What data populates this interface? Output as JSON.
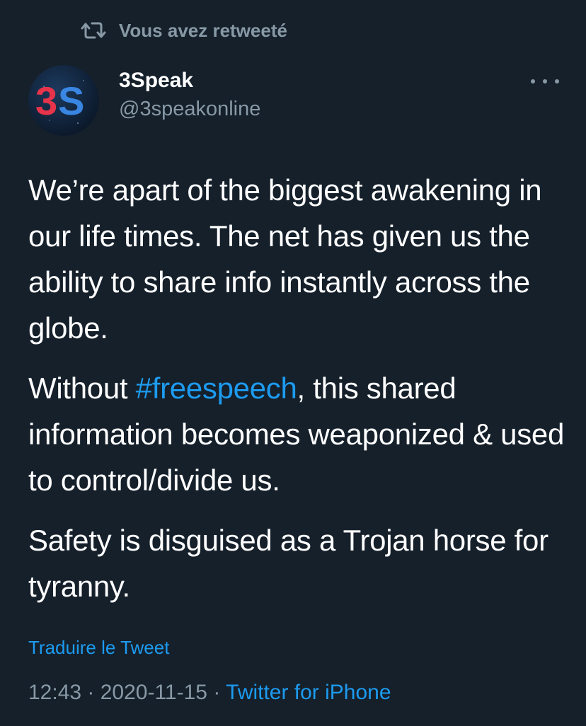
{
  "retweet": {
    "icon": "retweet-icon",
    "label": "Vous avez retweeté"
  },
  "author": {
    "avatar_text": "3S",
    "name": "3Speak",
    "handle": "@3speakonline"
  },
  "more_icon": "more-dots-icon",
  "tweet": {
    "paragraph1": "We’re apart of the biggest awakening in our life times. The net has given us the ability to share info instantly across the globe.",
    "paragraph2_before": "Without ",
    "hashtag": "#freespeech",
    "paragraph2_after": ", this shared information becomes weaponized & used to control/divide us.",
    "paragraph3": "Safety is disguised as a Trojan horse for tyranny."
  },
  "translate_label": "Traduire le Tweet",
  "meta": {
    "time": "12:43",
    "separator1": " · ",
    "date": "2020-11-15",
    "separator2": " · ",
    "source": "Twitter for iPhone"
  },
  "colors": {
    "background": "#15202b",
    "text": "#ffffff",
    "secondary": "#8899a6",
    "accent": "#1d9bf0",
    "logo_red": "#e8344a",
    "logo_blue": "#3d8ff0"
  }
}
